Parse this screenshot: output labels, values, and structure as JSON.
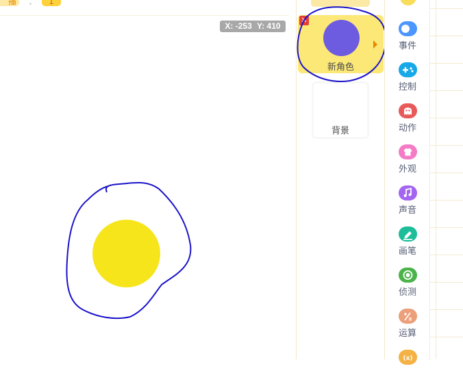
{
  "topbar": {
    "left_button_label": "播",
    "page_number": "1"
  },
  "stage": {
    "coords": {
      "x_label": "X: -253",
      "y_label": "Y: 410"
    },
    "sprite_color": "#f7e51c"
  },
  "sprite_panel": {
    "sprite": {
      "name": "新角色",
      "color": "#6d5be0",
      "delete_icon": "close-icon"
    },
    "backdrop": {
      "name": "背景"
    }
  },
  "categories": [
    {
      "label": "事件",
      "color": "#4c97ff",
      "icon": "toggle-icon"
    },
    {
      "label": "控制",
      "color": "#17a8e8",
      "icon": "gamepad-icon"
    },
    {
      "label": "动作",
      "color": "#e85a5a",
      "icon": "ghost-icon"
    },
    {
      "label": "外观",
      "color": "#f47cc7",
      "icon": "shirt-icon"
    },
    {
      "label": "声音",
      "color": "#a465f0",
      "icon": "music-icon"
    },
    {
      "label": "画笔",
      "color": "#1dbd9a",
      "icon": "pen-icon"
    },
    {
      "label": "侦测",
      "color": "#4ab34a",
      "icon": "target-icon"
    },
    {
      "label": "运算",
      "color": "#ec9f7b",
      "icon": "math-icon"
    },
    {
      "label": "",
      "color": "#f4b244",
      "icon": "variable-icon"
    }
  ],
  "annotation_color": "#1a12c8"
}
